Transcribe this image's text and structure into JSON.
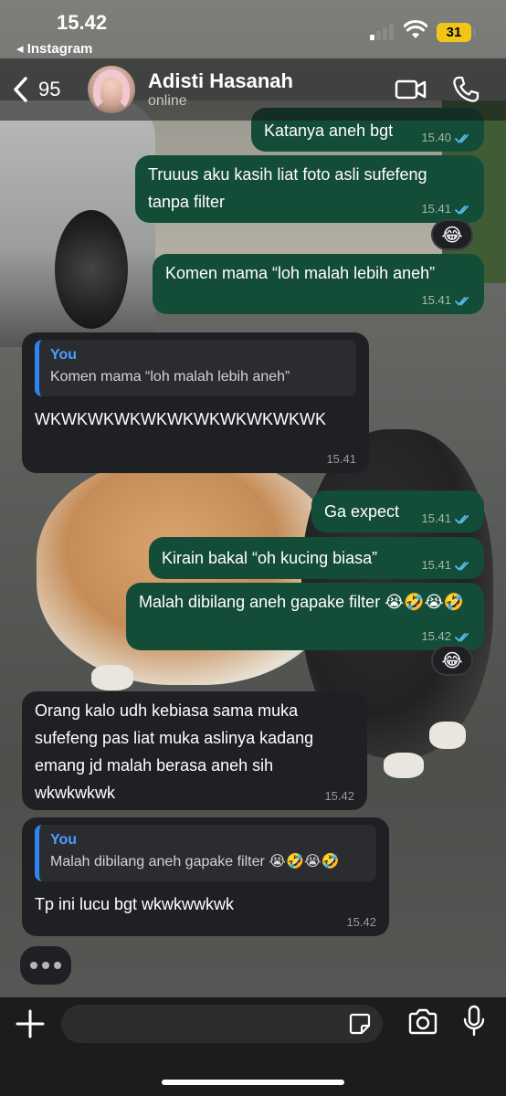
{
  "status_bar": {
    "time": "15.42",
    "back_app": "◂ Instagram",
    "battery": "31"
  },
  "header": {
    "back_count": "95",
    "contact_name": "Adisti Hasanah",
    "presence": "online"
  },
  "messages": [
    {
      "dir": "out",
      "text": "Katanya aneh bgt",
      "time": "15.40"
    },
    {
      "dir": "out",
      "text": "Truuus aku kasih liat foto asli sufefeng tanpa filter",
      "time": "15.41",
      "reaction": "😂"
    },
    {
      "dir": "out",
      "text": "Komen mama “loh malah lebih aneh”",
      "time": "15.41"
    },
    {
      "dir": "in",
      "quote_author": "You",
      "quote_text": "Komen mama “loh malah lebih aneh”",
      "text": "WKWKWKWKWKWKWKWKWKWKWK",
      "time": "15.41"
    },
    {
      "dir": "out",
      "text": "Ga expect",
      "time": "15.41"
    },
    {
      "dir": "out",
      "text": "Kirain bakal “oh kucing biasa”",
      "time": "15.41"
    },
    {
      "dir": "out",
      "text": "Malah dibilang aneh gapake filter 😭🤣😭🤣",
      "time": "15.42",
      "reaction": "😂"
    },
    {
      "dir": "in",
      "text": "Orang kalo udh kebiasa sama muka sufefeng pas liat muka aslinya kadang emang jd malah berasa aneh sih wkwkwkwk",
      "time": "15.42"
    },
    {
      "dir": "in",
      "quote_author": "You",
      "quote_text": "Malah dibilang aneh gapake filter 😭🤣😭🤣",
      "text": "Tp ini lucu bgt wkwkwwkwk",
      "time": "15.42"
    }
  ],
  "composer": {
    "placeholder": ""
  },
  "colors": {
    "outgoing_bubble": "#144d37",
    "incoming_bubble": "#1f2023",
    "read_tick": "#53bdeb",
    "quote_accent": "#2c86f0",
    "battery": "#f2c619"
  },
  "icons": [
    "back-chevron-icon",
    "video-call-icon",
    "phone-call-icon",
    "plus-icon",
    "sticker-icon",
    "camera-icon",
    "microphone-icon",
    "double-check-icon"
  ]
}
